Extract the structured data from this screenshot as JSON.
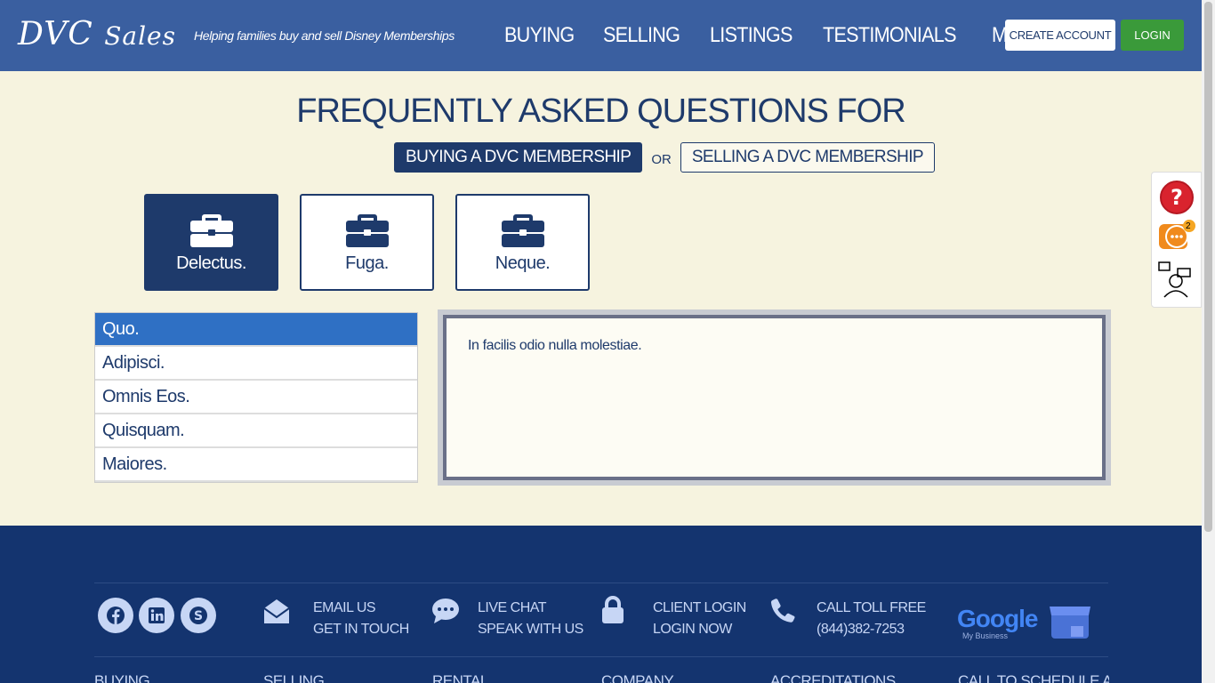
{
  "header": {
    "logo_main": "DVC ",
    "logo_sub": "Sales",
    "tagline": "Helping families buy and sell Disney Memberships",
    "nav": [
      "BUYING",
      "SELLING",
      "LISTINGS",
      "TESTIMONIALS",
      "MORE"
    ],
    "create_account": "CREATE ACCOUNT",
    "login": "LOGIN"
  },
  "faq": {
    "title": "FREQUENTLY ASKED QUESTIONS FOR",
    "toggle_buying": "BUYING A DVC MEMBERSHIP",
    "or": "OR",
    "toggle_selling": "SELLING A DVC MEMBERSHIP",
    "categories": [
      {
        "label": "Delectus.",
        "active": true
      },
      {
        "label": "Fuga.",
        "active": false
      },
      {
        "label": "Neque.",
        "active": false
      }
    ],
    "questions": [
      {
        "label": "Quo.",
        "active": true
      },
      {
        "label": "Adipisci.",
        "active": false
      },
      {
        "label": "Omnis Eos.",
        "active": false
      },
      {
        "label": "Quisquam.",
        "active": false
      },
      {
        "label": "Maiores.",
        "active": false
      }
    ],
    "answer": "In facilis odio nulla molestiae."
  },
  "widget": {
    "chat_badge": "2"
  },
  "footer": {
    "email_title": "EMAIL US",
    "email_sub": "GET IN TOUCH",
    "chat_title": "LIVE CHAT",
    "chat_sub": "SPEAK WITH US",
    "client_title": "CLIENT LOGIN",
    "client_sub": "LOGIN NOW",
    "call_title": "CALL TOLL FREE",
    "call_sub": "(844)382-7253",
    "google_word": "Google",
    "google_sub": "My Business",
    "columns": [
      "BUYING",
      "SELLING",
      "RENTAL",
      "COMPANY",
      "ACCREDITATIONS",
      "CALL TO SCHEDULE AN"
    ]
  },
  "colors": {
    "header_bg": "#3a5fa0",
    "navy": "#1e3a6b",
    "footer_bg": "#14346f",
    "login_green": "#3a9a3a",
    "active_question": "#2f70c4"
  }
}
